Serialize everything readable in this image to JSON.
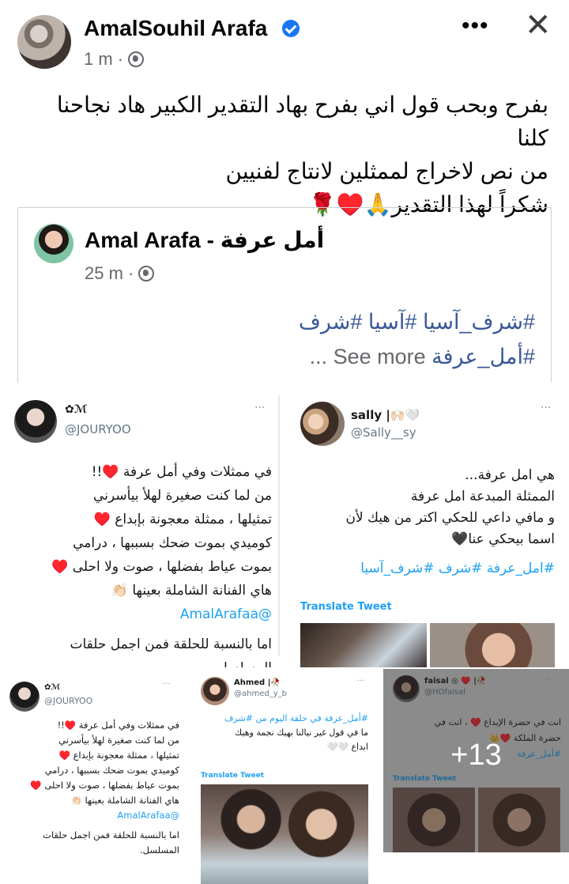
{
  "post": {
    "author": "AmalSouhil Arafa",
    "time": "1 m ·",
    "more_icon": "more-horizontal-icon",
    "close_icon": "close-icon",
    "lines": [
      "بفرح وبحب قول اني بفرح بهاد التقدير الكبير هاد نجاحنا كلنا",
      "من  نص لاخراج لممثلين لانتاج لفنيين",
      "شكراً لهذا التقدير🙏♥️🌹"
    ]
  },
  "shared": {
    "author": "Amal Arafa - أمل عرفة",
    "time": "25 m ·",
    "hashtags_line": "#شرف_آسيا #آسيا #شرف",
    "hashtag_last": "#أمل_عرفة",
    "see_more": "See more ..."
  },
  "tweets": {
    "t1": {
      "name": "✿ℳ",
      "handle": "@JOURYOO",
      "dots": "···",
      "lines": [
        "في ممثلات وفي أمل عرفة ♥️!!",
        "من لما كنت صغيرة لهلأ بيأسرني",
        "تمثيلها ، ممثلة معجونة بإبداع ♥️",
        "كوميدي بموت ضحك بسببها ، درامي",
        "بموت عياط بفضلها ، صوت ولا احلى ♥️",
        "هاي الفنانة الشاملة بعينها 👏🏻"
      ],
      "mention": "@AmalArafaa",
      "tail": [
        "اما بالنسبة للحلقة فمن اجمل حلقات",
        "المسلسل"
      ]
    },
    "t2": {
      "name": "sally |🙌🏻🤍",
      "handle": "@Sally__sy",
      "dots": "···",
      "lines": [
        "هي امل عرفة...",
        "الممثلة المبدعة امل عرفة",
        "و مافي داعي للحكي اكتر من هيك لأن",
        "اسما بيحكي عنا🖤"
      ],
      "tags": "#امل_عرفة #شرف #شرف_آسيا",
      "translate": "Translate Tweet"
    },
    "t3": {
      "name": "✿ℳ",
      "handle": "@JOURYOO",
      "dots": "···",
      "lines": [
        "في ممثلات وفي أمل عرفة ♥️!!",
        "من لما كنت صغيرة لهلأ بيأسرني",
        "تمثيلها ، ممثلة معجونة بإبداع ♥️",
        "كوميدي بموت ضحك بسببها ، درامي",
        "بموت عياط بفضلها ، صوت ولا احلى ♥️",
        "هاي الفنانة الشاملة بعينها 👏🏻"
      ],
      "mention": "@AmalArafaa",
      "tail": [
        "اما بالنسبة للحلقة فمن اجمل حلقات",
        "المسلسل."
      ]
    },
    "t4": {
      "name": "Ahmed |🥀",
      "handle": "@ahmed_y_b",
      "dots": "···",
      "lines": [
        "#أمل_عرفة في حلقة اليوم من #شرف",
        "ما في قول غير نيالنا بهيك نجمة وهيك",
        "ابداع 🤍🤍"
      ],
      "translate": "Translate Tweet"
    },
    "t5": {
      "name": "faisal ◎ ♥️ |🥀",
      "handle": "@HOfaisal",
      "dots": "···",
      "lines": [
        "انت في حضرة الإبداع ♥️ ، انت في",
        "حضرة الملكة ♥️👑",
        "#أمل_عرفة"
      ],
      "translate": "Translate Tweet",
      "more_count": "+13"
    }
  }
}
